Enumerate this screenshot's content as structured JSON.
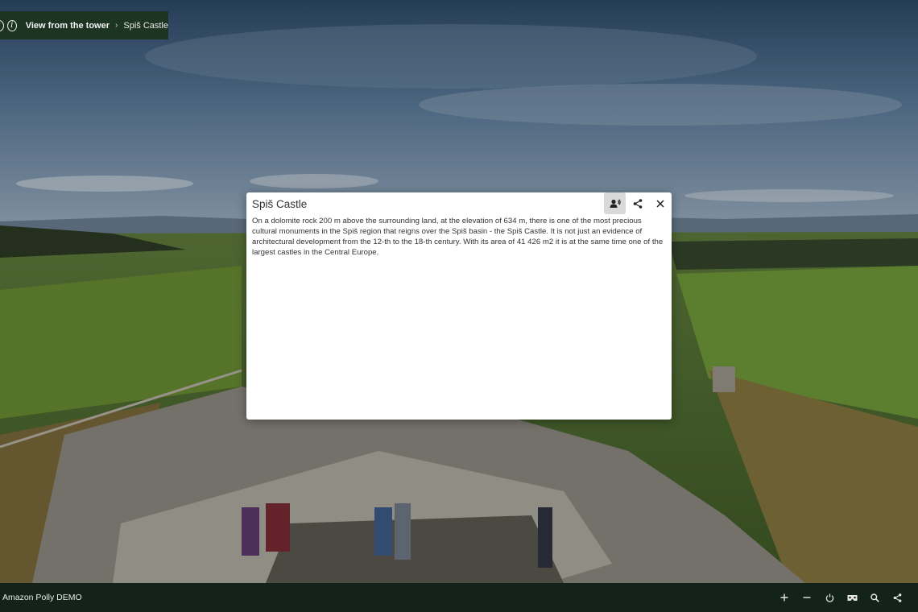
{
  "breadcrumb": {
    "parent": "View from the tower",
    "separator": "›",
    "current": "Spiš Castle"
  },
  "popup": {
    "title": "Spiš Castle",
    "body": "On a dolomite rock 200 m above the surrounding land, at the elevation of 634 m, there is one of the most precious cultural monuments in the Spiš region that reigns over the Spiš basin - the Spiš Castle. It is not just an evidence of architectural development from the 12-th to the 18-th century. With its area of 41 426 m2 it is at the same time one of the largest castles in the Central Europe.",
    "buttons": [
      "speak-icon",
      "share-icon",
      "close-icon"
    ]
  },
  "bottombar": {
    "title": "Amazon Polly DEMO",
    "tools": [
      "zoom-in-icon",
      "zoom-out-icon",
      "autorotate-icon",
      "vr-icon",
      "search-icon",
      "share-icon"
    ]
  },
  "colors": {
    "bar": "#13231a",
    "breadcrumb": "#1d3423",
    "popup": "#ffffff",
    "speak_button_bg": "#d9d9d9"
  }
}
